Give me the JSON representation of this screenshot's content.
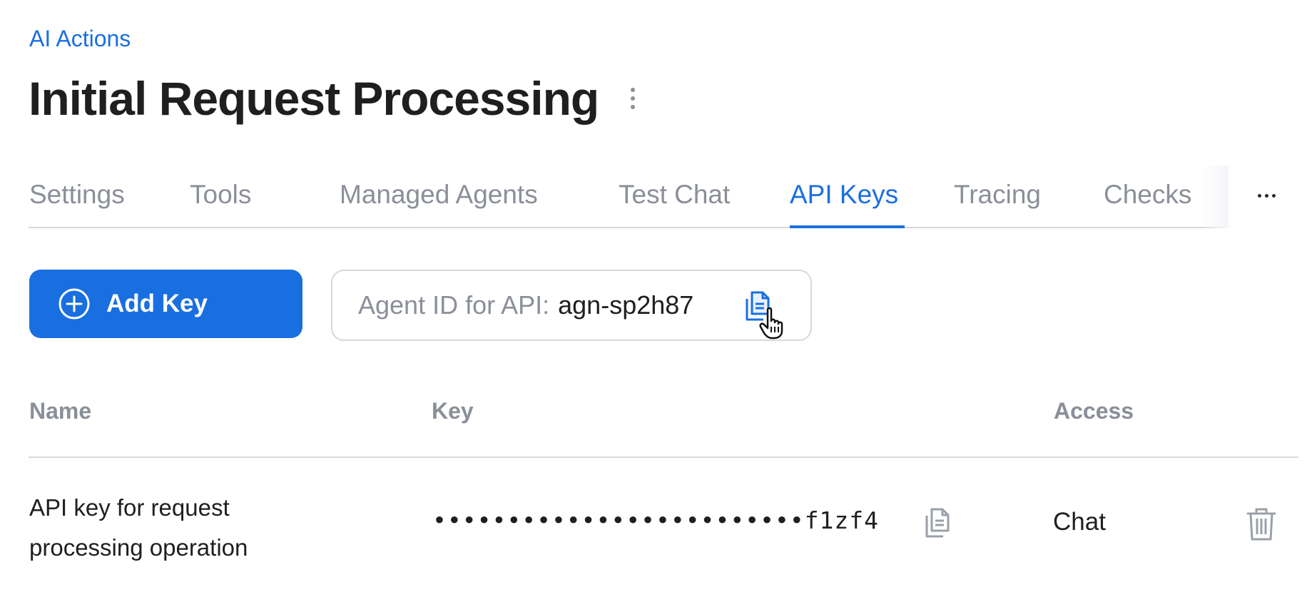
{
  "breadcrumb": {
    "label": "AI Actions"
  },
  "header": {
    "title": "Initial Request Processing"
  },
  "tabs": [
    {
      "label": "Settings",
      "active": false
    },
    {
      "label": "Tools",
      "active": false
    },
    {
      "label": "Managed Agents",
      "active": false
    },
    {
      "label": "Test Chat",
      "active": false
    },
    {
      "label": "API Keys",
      "active": true
    },
    {
      "label": "Tracing",
      "active": false
    },
    {
      "label": "Checks",
      "active": false
    }
  ],
  "toolbar": {
    "add_key_label": "Add Key",
    "agent_id_label": "Agent ID for API:",
    "agent_id_value": "agn-sp2h87"
  },
  "table": {
    "columns": [
      "Name",
      "Key",
      "Access"
    ],
    "rows": [
      {
        "name_line1": "API key for request",
        "name_line2": "processing operation",
        "key_masked": "•••••••••••••••••••••••••f1zf4",
        "access": "Chat"
      }
    ]
  },
  "icons": {
    "add": "plus-circle-icon",
    "copy": "copy-icon",
    "delete": "trash-icon",
    "more": "more-horizontal-icon",
    "title_menu": "more-vertical-icon",
    "pointer": "hand-pointer-icon"
  },
  "colors": {
    "accent": "#1a6fe0",
    "muted_text": "#8a8f98",
    "divider": "#d6d8dc",
    "text": "#1f1f1f"
  }
}
